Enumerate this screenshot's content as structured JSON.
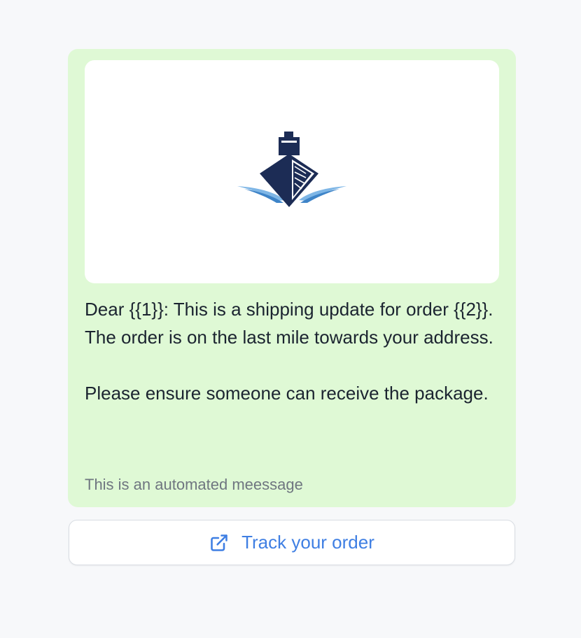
{
  "message": {
    "header_image": {
      "icon": "ship-logo-icon",
      "colors": {
        "hull": "#1c2c55",
        "wave_light": "#7eb6e6",
        "wave_dark": "#3e84c8"
      }
    },
    "body_paragraphs": [
      "Dear {{1}}: This is a shipping update for order {{2}}. The order is on the last mile towards your address.",
      "Please ensure someone can receive the package."
    ],
    "footer": "This is an automated meessage"
  },
  "button": {
    "label": "Track your order",
    "icon": "external-link-icon"
  },
  "colors": {
    "background": "#f7f8fa",
    "card": "#dff9d5",
    "button_text": "#3f7fe3",
    "body_text": "#1b2430",
    "footer_text": "#6f7680"
  }
}
